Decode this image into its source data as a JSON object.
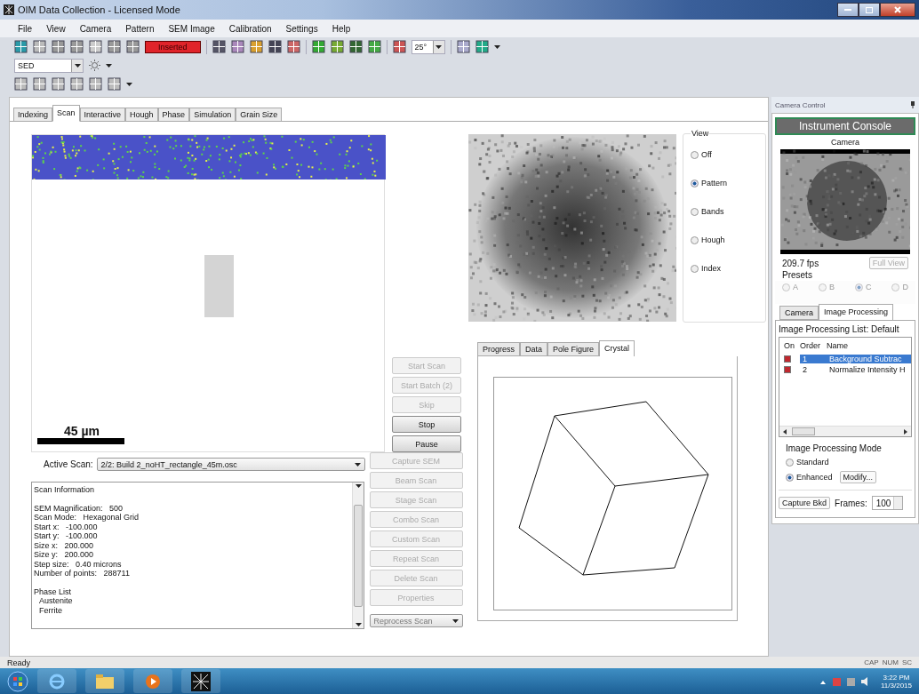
{
  "window": {
    "title": "OIM Data Collection - Licensed Mode"
  },
  "menu": [
    "File",
    "View",
    "Camera",
    "Pattern",
    "SEM Image",
    "Calibration",
    "Settings",
    "Help"
  ],
  "toolbar": {
    "status_badge": "Inserted",
    "angle": "25°"
  },
  "detector": {
    "value": "SED"
  },
  "tabs": [
    {
      "label": "Indexing",
      "selected": false
    },
    {
      "label": "Scan",
      "selected": true
    },
    {
      "label": "Interactive",
      "selected": false
    },
    {
      "label": "Hough",
      "selected": false
    },
    {
      "label": "Phase",
      "selected": false
    },
    {
      "label": "Simulation",
      "selected": false
    },
    {
      "label": "Grain Size",
      "selected": false
    }
  ],
  "sem_map": {
    "scale_label": "45 µm"
  },
  "scan_buttons": [
    {
      "label": "Start Scan",
      "disabled": true
    },
    {
      "label": "Start Batch (2)",
      "disabled": true
    },
    {
      "label": "Skip",
      "disabled": true
    },
    {
      "label": "Stop",
      "disabled": false
    },
    {
      "label": "Pause",
      "disabled": false
    }
  ],
  "view": {
    "title": "View",
    "options": [
      {
        "label": "Off",
        "selected": false
      },
      {
        "label": "Pattern",
        "selected": true
      },
      {
        "label": "Bands",
        "selected": false
      },
      {
        "label": "Hough",
        "selected": false
      },
      {
        "label": "Index",
        "selected": false
      }
    ]
  },
  "result_tabs": [
    {
      "label": "Progress",
      "selected": false
    },
    {
      "label": "Data",
      "selected": false
    },
    {
      "label": "Pole Figure",
      "selected": false
    },
    {
      "label": "Crystal",
      "selected": true
    }
  ],
  "active_scan": {
    "label": "Active Scan:",
    "value": "2/2: Build 2_noHT_rectangle_45m.osc"
  },
  "scan_info": {
    "title": "Scan Information",
    "lines": [
      "SEM Magnification:   500",
      "Scan Mode:   Hexagonal Grid",
      "Start x:   -100.000",
      "Start y:   -100.000",
      "Size x:   200.000",
      "Size y:   200.000",
      "Step size:   0.40 microns",
      "Number of points:   288711"
    ],
    "phase_title": "Phase List",
    "phases": [
      "Austenite",
      "Ferrite"
    ]
  },
  "scan_actions": [
    {
      "label": "Capture SEM",
      "disabled": true
    },
    {
      "label": "Beam Scan",
      "disabled": true
    },
    {
      "label": "Stage Scan",
      "disabled": true
    },
    {
      "label": "Combo Scan",
      "disabled": true
    },
    {
      "label": "Custom Scan",
      "disabled": true
    },
    {
      "label": "Repeat Scan",
      "disabled": true
    },
    {
      "label": "Delete Scan",
      "disabled": true
    },
    {
      "label": "Properties",
      "disabled": true
    }
  ],
  "reprocess": {
    "value": "Reprocess Scan"
  },
  "camera_panel": {
    "title": "Camera Control",
    "console_button": "Instrument Console",
    "camera_label": "Camera",
    "fps": "209.7 fps",
    "full_view": "Full View",
    "presets_label": "Presets",
    "presets_disabled": true,
    "presets": [
      {
        "label": "A",
        "selected": false
      },
      {
        "label": "B",
        "selected": false
      },
      {
        "label": "C",
        "selected": true
      },
      {
        "label": "D",
        "selected": false
      }
    ],
    "tabs": [
      {
        "label": "Camera",
        "selected": false
      },
      {
        "label": "Image Processing",
        "selected": true
      }
    ],
    "list_title": "Image Processing List: Default",
    "columns": [
      "On",
      "Order",
      "Name"
    ],
    "rows": [
      {
        "on": true,
        "order": "1",
        "name": "Background Subtrac",
        "selected": true
      },
      {
        "on": true,
        "order": "2",
        "name": "Normalize Intensity H",
        "selected": false
      }
    ],
    "mode_title": "Image Processing Mode",
    "modes": [
      {
        "label": "Standard",
        "selected": false
      },
      {
        "label": "Enhanced",
        "selected": true
      }
    ],
    "modify": "Modify...",
    "capture": "Capture Bkd",
    "frames_label": "Frames:",
    "frames": "100"
  },
  "status_bar": {
    "left": "Ready",
    "indicators": [
      "CAP",
      "NUM",
      "SC"
    ]
  },
  "taskbar": {
    "time": "3:22 PM",
    "date": "11/3/2015"
  }
}
